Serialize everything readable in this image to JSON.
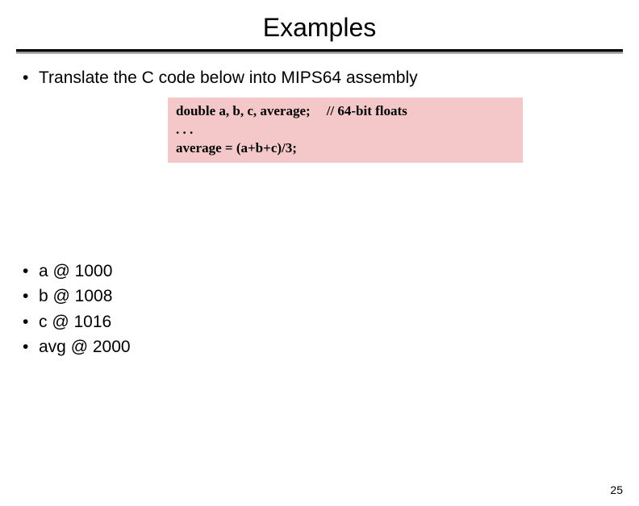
{
  "title": "Examples",
  "intro": "Translate the C code below into MIPS64 assembly",
  "code": {
    "line1_decl": "double a, b, c, average;",
    "line1_comment": "// 64-bit floats",
    "line2": ". . .",
    "line3": "average = (a+b+c)/3;"
  },
  "memory": {
    "a": "a @ 1000",
    "b": "b @ 1008",
    "c": "c @ 1016",
    "avg": "avg @ 2000"
  },
  "page_number": "25"
}
